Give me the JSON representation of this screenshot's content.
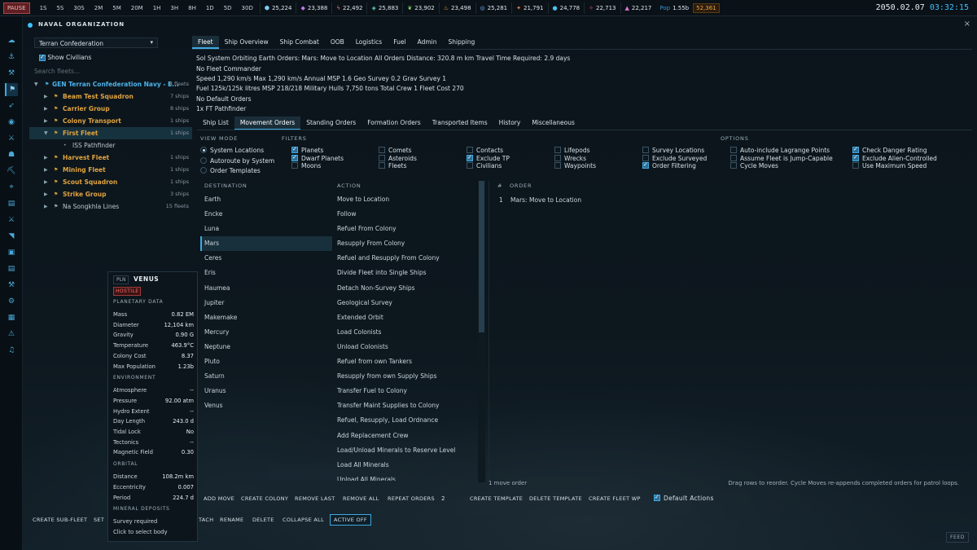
{
  "topbar": {
    "pause": "PAUSE",
    "speeds": [
      "1S",
      "5S",
      "30S",
      "2M",
      "5M",
      "20M",
      "1H",
      "3H",
      "8H",
      "1D",
      "5D",
      "30D"
    ],
    "resources": [
      {
        "icon": "hexagon-icon",
        "value": "25,224",
        "color": "#7fd0f5"
      },
      {
        "icon": "diamond-icon",
        "value": "23,388",
        "color": "#c27be8"
      },
      {
        "icon": "bolt-icon",
        "value": "22,492",
        "color": "#f07c7c"
      },
      {
        "icon": "gem-icon",
        "value": "25,883",
        "color": "#5fd0c7"
      },
      {
        "icon": "leaf-icon",
        "value": "23,902",
        "color": "#7ed66e"
      },
      {
        "icon": "flame-icon",
        "value": "23,498",
        "color": "#e8b04a"
      },
      {
        "icon": "ring-icon",
        "value": "25,281",
        "color": "#6fb9ff"
      },
      {
        "icon": "crystal-icon",
        "value": "21,791",
        "color": "#f08a4a"
      },
      {
        "icon": "drop-icon",
        "value": "24,778",
        "color": "#4ac3e8"
      },
      {
        "icon": "spark-icon",
        "value": "22,713",
        "color": "#e85a5a"
      },
      {
        "icon": "ore-icon",
        "value": "22,217",
        "color": "#d57ad9"
      }
    ],
    "pop_label": "Pop",
    "pop_value": "1.55b",
    "wealth": "52,361",
    "date": "2050.02.07",
    "time": "03:32:15"
  },
  "sidebar_icons": [
    "cloud-icon",
    "anchor-icon",
    "wrench-icon",
    "flag-icon",
    "rocket-icon",
    "target-icon",
    "crossed-swords-icon",
    "person-icon",
    "pickaxe-icon",
    "telescope-icon",
    "clipboard-icon",
    "crossed-swords-icon",
    "tag-icon",
    "box-icon",
    "clipboard-icon",
    "wrench-icon",
    "gear-icon",
    "chart-icon",
    "warning-icon",
    "music-icon"
  ],
  "window": {
    "title": "NAVAL ORGANIZATION",
    "close": "×"
  },
  "left": {
    "empire": "Terran Confederation",
    "show_civilians": "Show Civilians",
    "search_placeholder": "Search fleets...",
    "tree": [
      {
        "name": "GEN Terran Confederation Navy - E...",
        "count": "8 fleets",
        "type": "root"
      },
      {
        "name": "Beam Test Squadron",
        "count": "7 ships",
        "type": "fleet"
      },
      {
        "name": "Carrier Group",
        "count": "8 ships",
        "type": "fleet"
      },
      {
        "name": "Colony Transport",
        "count": "1 ships",
        "type": "fleet"
      },
      {
        "name": "First Fleet",
        "count": "1 ships",
        "type": "fleet-selected"
      },
      {
        "name": "ISS Pathfinder",
        "count": "",
        "type": "child"
      },
      {
        "name": "Harvest Fleet",
        "count": "1 ships",
        "type": "fleet"
      },
      {
        "name": "Mining Fleet",
        "count": "1 ships",
        "type": "fleet"
      },
      {
        "name": "Scout Squadron",
        "count": "1 ships",
        "type": "fleet"
      },
      {
        "name": "Strike Group",
        "count": "3 ships",
        "type": "fleet"
      },
      {
        "name": "Na Songkhla Lines",
        "count": "15 fleets",
        "type": "muted"
      }
    ]
  },
  "tabs": [
    "Fleet",
    "Ship Overview",
    "Ship Combat",
    "OOB",
    "Logistics",
    "Fuel",
    "Admin",
    "Shipping"
  ],
  "fleet_info": [
    "Sol System Orbiting Earth Orders: Mars: Move to Location All Orders Distance: 320.8 m km Travel Time Required: 2.9 days",
    "No Fleet Commander",
    "Speed 1,290 km/s Max 1,290 km/s Annual MSP 1.6 Geo Survey 0.2 Grav Survey 1",
    "Fuel 125k/125k litres MSP 218/218 Military Hulls 7,750 tons Total Crew 1 Fleet Cost 270",
    "No Default Orders",
    "1x FT Pathfinder"
  ],
  "subtabs": [
    "Ship List",
    "Movement Orders",
    "Standing Orders",
    "Formation Orders",
    "Transported Items",
    "History",
    "Miscellaneous"
  ],
  "view_mode": {
    "heading": "VIEW MODE",
    "options": [
      {
        "label": "System Locations",
        "on": true
      },
      {
        "label": "Autoroute by System",
        "on": false
      },
      {
        "label": "Order Templates",
        "on": false
      }
    ]
  },
  "filters": {
    "heading": "FILTERS",
    "cols": [
      [
        {
          "label": "Planets",
          "on": true
        },
        {
          "label": "Dwarf Planets",
          "on": true
        },
        {
          "label": "Moons",
          "on": false
        }
      ],
      [
        {
          "label": "Comets",
          "on": false
        },
        {
          "label": "Asteroids",
          "on": false
        },
        {
          "label": "Fleets",
          "on": false
        }
      ],
      [
        {
          "label": "Contacts",
          "on": false
        },
        {
          "label": "Exclude TP",
          "on": true
        },
        {
          "label": "Civilians",
          "on": false
        }
      ],
      [
        {
          "label": "Lifepods",
          "on": false
        },
        {
          "label": "Wrecks",
          "on": false
        },
        {
          "label": "Waypoints",
          "on": false
        }
      ],
      [
        {
          "label": "Survey Locations",
          "on": false
        },
        {
          "label": "Exclude Surveyed",
          "on": false
        },
        {
          "label": "Order Filtering",
          "on": true
        }
      ]
    ]
  },
  "options": {
    "heading": "OPTIONS",
    "cols": [
      [
        {
          "label": "Auto-include Lagrange Points",
          "on": false
        },
        {
          "label": "Assume Fleet is Jump-Capable",
          "on": false
        },
        {
          "label": "Cycle Moves",
          "on": false
        }
      ],
      [
        {
          "label": "Check Danger Rating",
          "on": true
        },
        {
          "label": "Exclude Alien-Controlled",
          "on": true
        },
        {
          "label": "Use Maximum Speed",
          "on": false
        }
      ]
    ]
  },
  "columns": {
    "destination": "DESTINATION",
    "action": "ACTION",
    "num": "#",
    "order": "ORDER"
  },
  "destinations": [
    "Earth",
    "Encke",
    "Luna",
    "Mars",
    "Ceres",
    "Eris",
    "Haumea",
    "Jupiter",
    "Makemake",
    "Mercury",
    "Neptune",
    "Pluto",
    "Saturn",
    "Uranus",
    "Venus"
  ],
  "selected_destination": "Mars",
  "actions": [
    "Move to Location",
    "Follow",
    "Refuel From Colony",
    "Resupply From Colony",
    "Refuel and Resupply From Colony",
    "Divide Fleet into Single Ships",
    "Detach Non-Survey Ships",
    "Geological Survey",
    "Extended Orbit",
    "Load Colonists",
    "Unload Colonists",
    "Refuel from own Tankers",
    "Resupply from own Supply Ships",
    "Transfer Fuel to Colony",
    "Transfer Maint Supplies to Colony",
    "Refuel, Resupply, Load Ordnance",
    "Add Replacement Crew",
    "Load/Unload Minerals to Reserve Level",
    "Load All Minerals",
    "Unload All Minerals"
  ],
  "orders": [
    {
      "num": "1",
      "text": "Mars: Move to Location"
    }
  ],
  "move_count": "1 move order",
  "hint": "Drag rows to reorder. Cycle Moves re-appends completed orders for patrol loops.",
  "order_buttons": {
    "add": "ADD MOVE",
    "colony": "CREATE COLONY",
    "remove_last": "REMOVE LAST",
    "remove_all": "REMOVE ALL",
    "repeat": "REPEAT ORDERS",
    "repeat_count": "2",
    "create_template": "CREATE TEMPLATE",
    "delete_template": "DELETE TEMPLATE",
    "create_wp": "CREATE FLEET WP",
    "default_actions": "Default Actions"
  },
  "bottom_buttons": {
    "sub_fleet": "CREATE SUB-FLEET",
    "set": "SET",
    "detach": "TACH",
    "rename": "RENAME",
    "delete": "DELETE",
    "collapse": "COLLAPSE ALL",
    "active": "ACTIVE OFF"
  },
  "planet": {
    "tag": "PLN",
    "name": "VENUS",
    "status": "HOSTILE",
    "sections": [
      {
        "title": "PLANETARY DATA",
        "rows": [
          [
            "Mass",
            "0.82 EM"
          ],
          [
            "Diameter",
            "12,104 km"
          ],
          [
            "Gravity",
            "0.90 G"
          ],
          [
            "Temperature",
            "463.9°C"
          ],
          [
            "Colony Cost",
            "8.37"
          ],
          [
            "Max Population",
            "1.23b"
          ]
        ]
      },
      {
        "title": "ENVIRONMENT",
        "rows": [
          [
            "Atmosphere",
            "--"
          ],
          [
            "Pressure",
            "92.00 atm"
          ],
          [
            "Hydro Extent",
            "--"
          ],
          [
            "Day Length",
            "243.0 d"
          ],
          [
            "Tidal Lock",
            "No"
          ],
          [
            "Tectonics",
            "--"
          ],
          [
            "Magnetic Field",
            "0.30"
          ]
        ]
      },
      {
        "title": "ORBITAL",
        "rows": [
          [
            "Distance",
            "108.2m km"
          ],
          [
            "Eccentricity",
            "0.007"
          ],
          [
            "Period",
            "224.7 d"
          ]
        ]
      },
      {
        "title": "MINERAL DEPOSITS",
        "rows": [
          [
            "Survey required",
            ""
          ],
          [
            "Click to select body",
            ""
          ]
        ]
      }
    ]
  },
  "feed": "FEED"
}
